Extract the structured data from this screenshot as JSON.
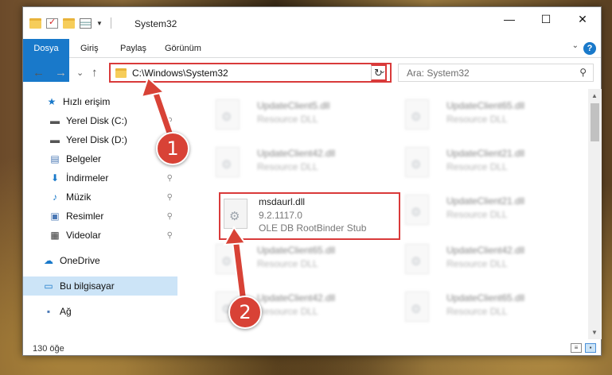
{
  "window": {
    "title": "System32",
    "controls": {
      "minimize": "—",
      "maximize": "☐",
      "close": "✕"
    }
  },
  "ribbon": {
    "tabs": [
      "Dosya",
      "Giriş",
      "Paylaş",
      "Görünüm"
    ],
    "help": "?"
  },
  "navigation": {
    "address": "C:\\Windows\\System32",
    "search_placeholder": "Ara: System32",
    "back": "←",
    "forward": "→",
    "recent": "⌄",
    "up": "↑",
    "refresh": "↻",
    "dropdown": "⌄",
    "search_icon": "⚲"
  },
  "sidebar": {
    "items": [
      {
        "label": "Hızlı erişim",
        "icon": "star-icon",
        "glyph": "★",
        "color": "#1979ca"
      },
      {
        "label": "Yerel Disk (C:)",
        "icon": "drive-icon",
        "glyph": "▬",
        "color": "#555555"
      },
      {
        "label": "Yerel Disk (D:)",
        "icon": "drive-icon",
        "glyph": "▬",
        "color": "#555555"
      },
      {
        "label": "Belgeler",
        "icon": "documents-icon",
        "glyph": "▤",
        "color": "#4a78b5"
      },
      {
        "label": "İndirmeler",
        "icon": "download-icon",
        "glyph": "⬇",
        "color": "#1979ca"
      },
      {
        "label": "Müzik",
        "icon": "music-icon",
        "glyph": "♪",
        "color": "#1979ca"
      },
      {
        "label": "Resimler",
        "icon": "pictures-icon",
        "glyph": "▣",
        "color": "#4a78b5"
      },
      {
        "label": "Videolar",
        "icon": "video-icon",
        "glyph": "▦",
        "color": "#333333"
      },
      {
        "label": "OneDrive",
        "icon": "cloud-icon",
        "glyph": "☁",
        "color": "#1979ca"
      },
      {
        "label": "Bu bilgisayar",
        "icon": "computer-icon",
        "glyph": "▭",
        "color": "#1979ca"
      },
      {
        "label": "Ağ",
        "icon": "network-icon",
        "glyph": "⬛",
        "color": "#4a78b5"
      }
    ],
    "pin": "📌"
  },
  "files": [
    {
      "name": "UpdateClient5.dll",
      "desc": "Resource DLL"
    },
    {
      "name": "UpdateClient65.dll",
      "desc": "Resource DLL"
    },
    {
      "name": "UpdateClient42.dll",
      "desc": "Resource DLL"
    },
    {
      "name": "UpdateClient21.dll",
      "desc": "Resource DLL"
    },
    {
      "name": "msdaurl.dll",
      "version": "9.2.1117.0",
      "desc": "OLE DB RootBinder Stub"
    },
    {
      "name": "UpdateClient21.dll",
      "desc": "Resource DLL"
    },
    {
      "name": "UpdateClient65.dll",
      "desc": "Resource DLL"
    },
    {
      "name": "UpdateClient42.dll",
      "desc": "Resource DLL"
    },
    {
      "name": "UpdateClient42.dll",
      "desc": "Resource DLL"
    },
    {
      "name": "UpdateClient65.dll",
      "desc": "Resource DLL"
    }
  ],
  "status": {
    "count": "130 öğe"
  },
  "annotations": {
    "step1": "1",
    "step2": "2",
    "accent": "#d84236"
  }
}
